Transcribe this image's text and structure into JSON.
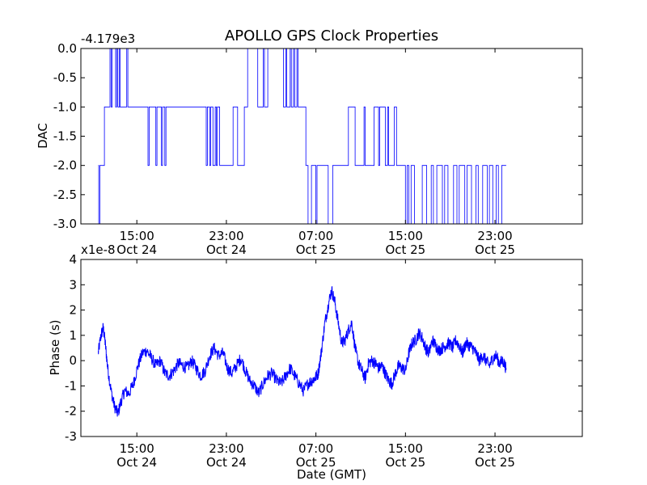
{
  "figure": {
    "title": "APOLLO GPS Clock Properties",
    "xlabel": "Date (GMT)"
  },
  "chart_data": [
    {
      "type": "line",
      "title": "APOLLO GPS Clock Properties",
      "xlabel": "",
      "ylabel": "DAC",
      "offset_text": "-4.179e3",
      "ylim": [
        -3.0,
        0.0
      ],
      "xlim_hours": [
        10.0,
        34.2
      ],
      "x_ticks": [
        {
          "hour": 15,
          "line1": "15:00",
          "line2": "Oct 24"
        },
        {
          "hour": 23,
          "line1": "23:00",
          "line2": "Oct 24"
        },
        {
          "hour": 31,
          "line1": "07:00",
          "line2": "Oct 25"
        },
        {
          "hour": 39,
          "line1": "15:00",
          "line2": "Oct 25"
        },
        {
          "hour": 47,
          "line1": "23:00",
          "line2": "Oct 25"
        }
      ],
      "y_ticks": [
        "0.0",
        "-0.5",
        "-1.0",
        "-1.5",
        "-2.0",
        "-2.5",
        "-3.0"
      ],
      "y_tick_values": [
        0.0,
        -0.5,
        -1.0,
        -1.5,
        -2.0,
        -2.5,
        -3.0
      ],
      "series": [
        {
          "color": "#0000ff",
          "x_hours": [
            11.55,
            11.6,
            11.6,
            11.7,
            11.7,
            12.1,
            12.1,
            12.6,
            12.6,
            12.7,
            12.7,
            12.8,
            12.8,
            13.1,
            13.1,
            13.2,
            13.2,
            13.3,
            13.3,
            13.45,
            13.45,
            13.5,
            13.5,
            14.1,
            14.1,
            14.2,
            14.2,
            16.0,
            16.0,
            16.1,
            16.1,
            16.7,
            16.7,
            16.8,
            16.8,
            17.2,
            17.2,
            17.3,
            17.3,
            17.5,
            17.5,
            17.6,
            17.6,
            17.7,
            17.7,
            21.2,
            21.2,
            21.3,
            21.3,
            21.5,
            21.5,
            21.6,
            21.6,
            21.8,
            21.8,
            22.0,
            22.0,
            22.1,
            22.1,
            22.2,
            22.2,
            22.4,
            22.4,
            23.6,
            23.6,
            24.0,
            24.0,
            24.6,
            24.6,
            24.9,
            24.9,
            25.8,
            25.8,
            26.3,
            26.3,
            26.4,
            26.4,
            26.7,
            26.7,
            28.1,
            28.1,
            28.3,
            28.3,
            28.4,
            28.4,
            28.7,
            28.7,
            28.8,
            28.8,
            29.0,
            29.0,
            29.1,
            29.1,
            29.3,
            29.3,
            29.4,
            29.4,
            29.7,
            29.7,
            30.1,
            30.1,
            30.3,
            30.3,
            30.6,
            30.6,
            31.0,
            31.0,
            31.1,
            31.1,
            31.3,
            31.3,
            32.1,
            32.1,
            32.5,
            32.5,
            33.9,
            33.9,
            34.5,
            34.5,
            35.3,
            35.3,
            35.4,
            35.4,
            36.2,
            36.2,
            36.6,
            36.6,
            36.7,
            36.7,
            37.2,
            37.2,
            37.4,
            37.4,
            37.5,
            37.5,
            38.0,
            38.0,
            38.2,
            38.2,
            39.0,
            39.0,
            39.15,
            39.15,
            39.3,
            39.3,
            39.5,
            39.5,
            39.8,
            39.8,
            40.5,
            40.5,
            40.9,
            40.9,
            41.3,
            41.3,
            41.5,
            41.5,
            41.8,
            41.8,
            42.3,
            42.3,
            42.5,
            42.5,
            42.8,
            42.8,
            43.3,
            43.3,
            43.6,
            43.6,
            43.8,
            43.8,
            44.3,
            44.3,
            44.5,
            44.5,
            44.9,
            44.9,
            45.3,
            45.3,
            45.5,
            45.5,
            45.9,
            45.9,
            46.3,
            46.3,
            46.5,
            46.5,
            46.8,
            46.8,
            47.1,
            47.1,
            47.3,
            47.3,
            47.6,
            47.6,
            48.0,
            48.0
          ],
          "y": [
            -2.0,
            -2.0,
            -3.0,
            -3.0,
            -2.0,
            -2.0,
            -1.0,
            -1.0,
            0.0,
            0.0,
            -1.0,
            -1.0,
            0.0,
            0.0,
            -1.0,
            -1.0,
            0.0,
            0.0,
            -1.0,
            -1.0,
            0.0,
            0.0,
            -1.0,
            -1.0,
            0.0,
            0.0,
            -1.0,
            -1.0,
            -2.0,
            -2.0,
            -1.0,
            -1.0,
            -2.0,
            -2.0,
            -1.0,
            -1.0,
            -2.0,
            -2.0,
            -1.0,
            -1.0,
            -2.0,
            -2.0,
            -1.0,
            -1.0,
            -1.0,
            -1.0,
            -2.0,
            -2.0,
            -1.0,
            -1.0,
            -2.0,
            -2.0,
            -1.0,
            -1.0,
            -2.0,
            -2.0,
            -1.0,
            -1.0,
            -2.0,
            -2.0,
            -1.0,
            -1.0,
            -2.0,
            -2.0,
            -1.0,
            -1.0,
            -2.0,
            -2.0,
            -1.0,
            -1.0,
            0.0,
            0.0,
            -1.0,
            -1.0,
            0.0,
            0.0,
            -1.0,
            -1.0,
            0.0,
            0.0,
            -1.0,
            -1.0,
            0.0,
            0.0,
            -1.0,
            -1.0,
            0.0,
            0.0,
            -1.0,
            -1.0,
            0.0,
            0.0,
            -1.0,
            -1.0,
            0.0,
            0.0,
            -1.0,
            -1.0,
            -1.0,
            -1.0,
            -2.0,
            -2.0,
            -3.0,
            -3.0,
            -2.0,
            -2.0,
            -3.0,
            -3.0,
            -2.0,
            -2.0,
            -2.0,
            -2.0,
            -3.0,
            -3.0,
            -2.0,
            -2.0,
            -1.0,
            -1.0,
            -2.0,
            -2.0,
            -1.0,
            -1.0,
            -2.0,
            -2.0,
            -1.0,
            -1.0,
            -2.0,
            -2.0,
            -1.0,
            -1.0,
            -2.0,
            -2.0,
            -1.0,
            -1.0,
            -2.0,
            -2.0,
            -1.0,
            -1.0,
            -2.0,
            -2.0,
            -3.0,
            -3.0,
            -2.0,
            -2.0,
            -3.0,
            -3.0,
            -2.0,
            -2.0,
            -3.0,
            -3.0,
            -2.0,
            -2.0,
            -3.0,
            -3.0,
            -2.0,
            -2.0,
            -3.0,
            -3.0,
            -2.0,
            -2.0,
            -3.0,
            -3.0,
            -2.0,
            -2.0,
            -3.0,
            -3.0,
            -2.0,
            -2.0,
            -3.0,
            -3.0,
            -2.0,
            -2.0,
            -3.0,
            -3.0,
            -2.0,
            -2.0,
            -3.0,
            -3.0,
            -2.0,
            -2.0,
            -3.0,
            -3.0,
            -2.0,
            -2.0,
            -3.0,
            -3.0,
            -2.0,
            -2.0,
            -3.0,
            -3.0,
            -2.0,
            -2.0,
            -3.0,
            -3.0,
            -2.0,
            -2.0
          ]
        }
      ]
    },
    {
      "type": "line",
      "title": "",
      "xlabel": "Date (GMT)",
      "ylabel": "Phase (s)",
      "offset_text": "x1e-8",
      "ylim": [
        -3,
        4
      ],
      "xlim_hours": [
        10.0,
        34.2
      ],
      "x_ticks": [
        {
          "hour": 15,
          "line1": "15:00",
          "line2": "Oct 24"
        },
        {
          "hour": 23,
          "line1": "23:00",
          "line2": "Oct 24"
        },
        {
          "hour": 31,
          "line1": "07:00",
          "line2": "Oct 25"
        },
        {
          "hour": 39,
          "line1": "15:00",
          "line2": "Oct 25"
        },
        {
          "hour": 47,
          "line1": "23:00",
          "line2": "Oct 25"
        }
      ],
      "y_ticks": [
        "4",
        "3",
        "2",
        "1",
        "0",
        "-1",
        "-2",
        "-3"
      ],
      "y_tick_values": [
        4,
        3,
        2,
        1,
        0,
        -1,
        -2,
        -3
      ],
      "series": [
        {
          "color": "#0000ff",
          "x_hours": [
            11.55,
            11.8,
            12.0,
            12.2,
            12.4,
            12.7,
            13.0,
            13.3,
            13.6,
            13.9,
            14.3,
            14.7,
            15.1,
            15.5,
            15.9,
            16.3,
            16.7,
            17.1,
            17.5,
            17.9,
            18.3,
            18.7,
            19.1,
            19.5,
            19.9,
            20.3,
            20.7,
            21.1,
            21.5,
            21.9,
            22.3,
            22.7,
            23.1,
            23.5,
            23.9,
            24.3,
            24.7,
            25.1,
            25.5,
            25.9,
            26.3,
            26.7,
            27.1,
            27.5,
            27.9,
            28.3,
            28.7,
            29.1,
            29.5,
            29.9,
            30.3,
            30.6,
            30.9,
            31.2,
            31.5,
            31.8,
            32.1,
            32.4,
            32.7,
            33.0,
            33.3,
            33.6,
            33.9,
            34.2,
            34.5,
            34.8,
            35.1,
            35.4,
            35.7,
            36.0,
            36.3,
            36.6,
            36.9,
            37.2,
            37.5,
            37.8,
            38.1,
            38.4,
            38.7,
            39.0,
            39.3,
            39.6,
            39.9,
            40.2,
            40.5,
            40.8,
            41.1,
            41.4,
            41.7,
            42.0,
            42.3,
            42.6,
            42.9,
            43.2,
            43.5,
            43.8,
            44.1,
            44.4,
            44.7,
            45.0,
            45.3,
            45.6,
            45.9,
            46.2,
            46.5,
            46.8,
            47.1,
            47.4,
            47.7,
            48.0
          ],
          "y": [
            0.3,
            1.0,
            1.3,
            0.6,
            -0.3,
            -1.2,
            -1.8,
            -2.1,
            -1.6,
            -1.2,
            -1.3,
            -0.9,
            -0.2,
            0.3,
            0.4,
            0.1,
            -0.2,
            0.0,
            -0.5,
            -0.6,
            -0.4,
            -0.1,
            -0.2,
            -0.3,
            0.0,
            -0.3,
            -0.6,
            -0.4,
            0.2,
            0.5,
            0.2,
            0.3,
            -0.3,
            -0.5,
            -0.2,
            0.1,
            -0.4,
            -0.8,
            -1.0,
            -1.3,
            -0.9,
            -0.6,
            -0.5,
            -0.8,
            -0.9,
            -0.6,
            -0.3,
            -0.6,
            -0.9,
            -1.2,
            -0.9,
            -0.8,
            -0.7,
            -0.5,
            0.4,
            1.5,
            2.2,
            2.8,
            2.3,
            1.5,
            0.7,
            0.8,
            1.2,
            1.5,
            0.5,
            -0.1,
            -0.4,
            -0.7,
            -0.1,
            0.0,
            -0.1,
            -0.3,
            -0.2,
            -0.5,
            -0.8,
            -0.9,
            -0.5,
            -0.2,
            -0.3,
            -0.4,
            0.3,
            0.7,
            0.8,
            1.1,
            0.9,
            0.5,
            0.3,
            0.8,
            0.6,
            0.4,
            0.5,
            0.6,
            0.7,
            0.5,
            0.8,
            0.6,
            0.3,
            0.7,
            0.6,
            0.5,
            0.3,
            0.0,
            0.2,
            0.0,
            -0.2,
            0.1,
            0.2,
            -0.1,
            0.0,
            -0.3
          ],
          "noise": 0.25
        }
      ]
    }
  ]
}
